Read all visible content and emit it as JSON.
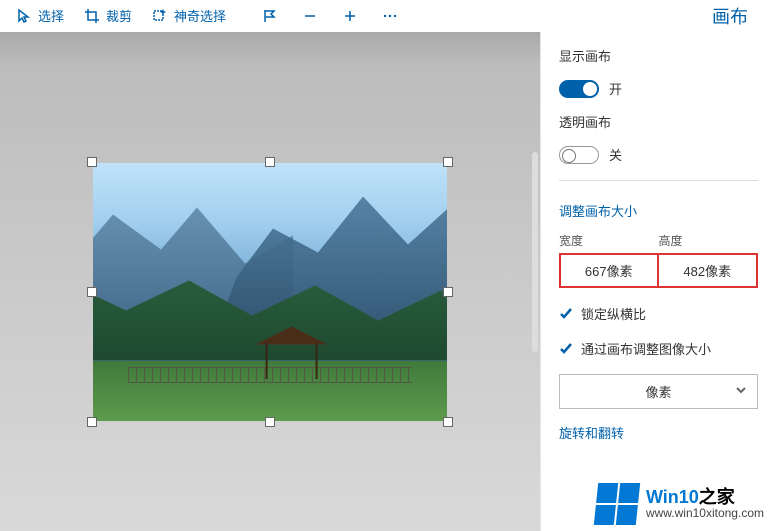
{
  "toolbar": {
    "select_label": "选择",
    "crop_label": "裁剪",
    "magic_label": "神奇选择"
  },
  "panel": {
    "title": "画布",
    "show_canvas_label": "显示画布",
    "show_canvas_state": "开",
    "transparent_canvas_label": "透明画布",
    "transparent_canvas_state": "关",
    "resize_heading": "调整画布大小",
    "width_label": "宽度",
    "height_label": "高度",
    "width_value": "667像素",
    "height_value": "482像素",
    "lock_aspect_label": "锁定纵横比",
    "resize_image_label": "通过画布调整图像大小",
    "unit_label": "像素",
    "rotate_flip_heading": "旋转和翻转"
  },
  "watermark": {
    "title_a": "Win10",
    "title_b": "之家",
    "url": "www.win10xitong.com"
  }
}
